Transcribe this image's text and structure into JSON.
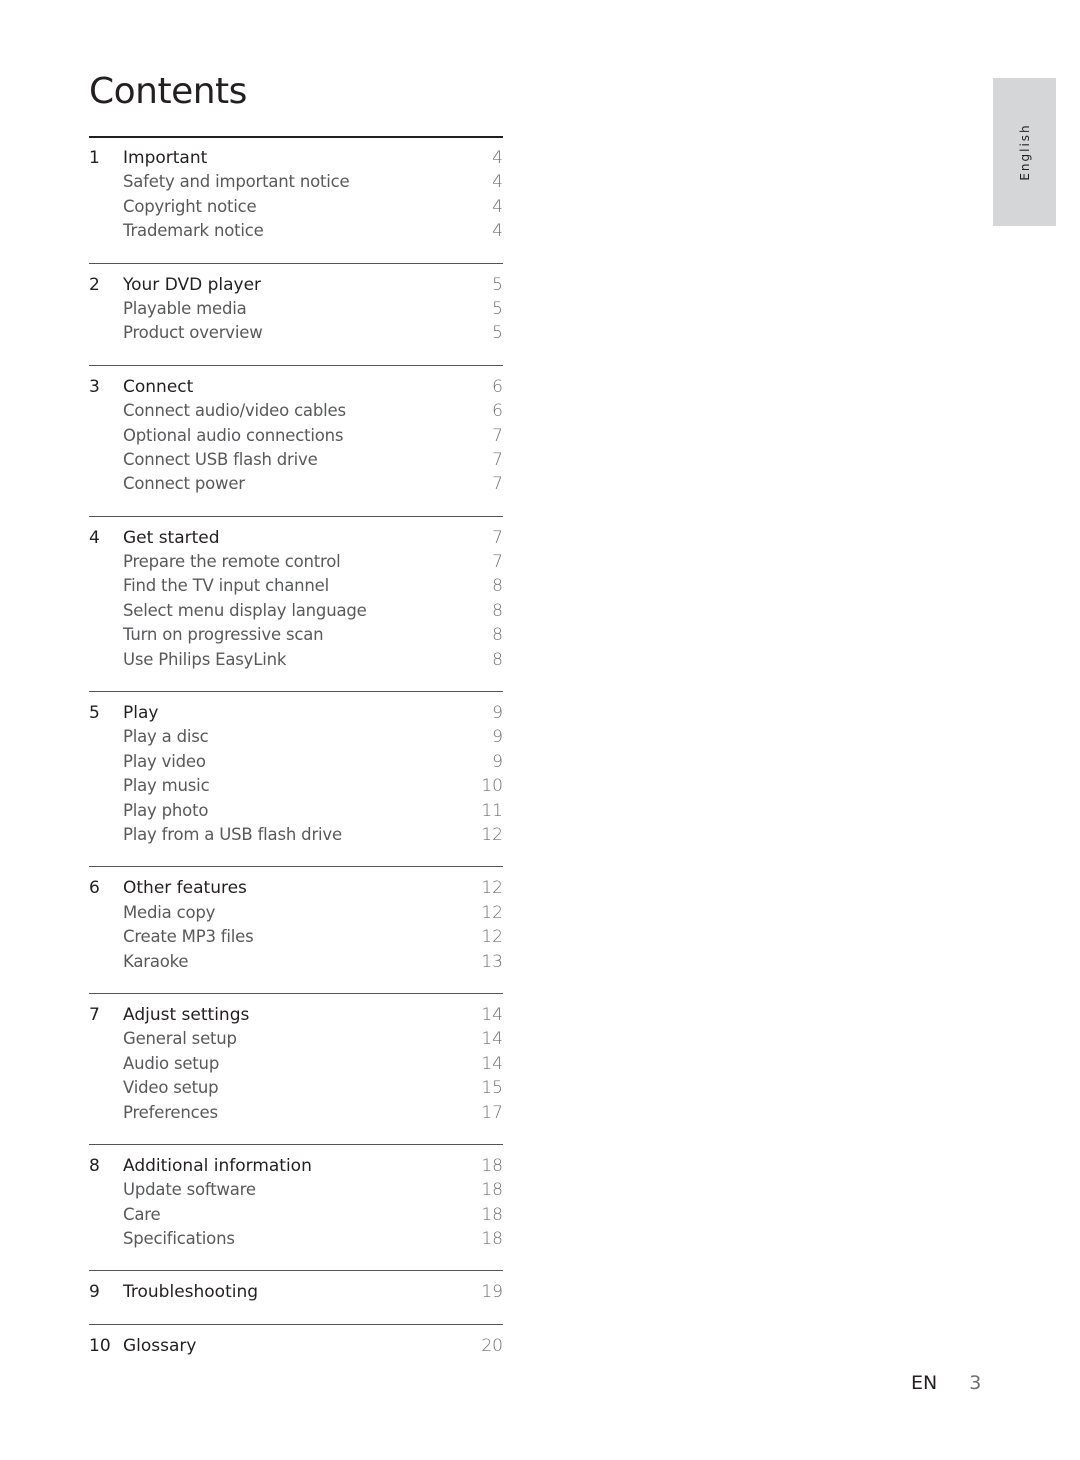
{
  "title": "Contents",
  "language_tab": "English",
  "footer": {
    "lang": "EN",
    "page": "3"
  },
  "sections": [
    {
      "num": "1",
      "title": "Important",
      "page": "4",
      "items": [
        {
          "label": "Safety and important notice",
          "page": "4"
        },
        {
          "label": "Copyright notice",
          "page": "4"
        },
        {
          "label": "Trademark notice",
          "page": "4"
        }
      ]
    },
    {
      "num": "2",
      "title": "Your DVD player",
      "page": "5",
      "items": [
        {
          "label": "Playable media",
          "page": "5"
        },
        {
          "label": "Product overview",
          "page": "5"
        }
      ]
    },
    {
      "num": "3",
      "title": "Connect",
      "page": "6",
      "items": [
        {
          "label": "Connect audio/video cables",
          "page": "6"
        },
        {
          "label": "Optional audio connections",
          "page": "7"
        },
        {
          "label": "Connect USB flash drive",
          "page": "7"
        },
        {
          "label": "Connect power",
          "page": "7"
        }
      ]
    },
    {
      "num": "4",
      "title": "Get started",
      "page": "7",
      "items": [
        {
          "label": "Prepare the remote control",
          "page": "7"
        },
        {
          "label": "Find the TV input channel",
          "page": "8"
        },
        {
          "label": "Select menu display language",
          "page": "8"
        },
        {
          "label": "Turn on progressive scan",
          "page": "8"
        },
        {
          "label": "Use Philips EasyLink",
          "page": "8"
        }
      ]
    },
    {
      "num": "5",
      "title": "Play",
      "page": "9",
      "items": [
        {
          "label": "Play a disc",
          "page": "9"
        },
        {
          "label": "Play video",
          "page": "9"
        },
        {
          "label": "Play music",
          "page": "10"
        },
        {
          "label": "Play photo",
          "page": "11"
        },
        {
          "label": "Play from a USB flash drive",
          "page": "12"
        }
      ]
    },
    {
      "num": "6",
      "title": "Other features",
      "page": "12",
      "items": [
        {
          "label": "Media copy",
          "page": "12"
        },
        {
          "label": "Create MP3 files",
          "page": "12"
        },
        {
          "label": "Karaoke",
          "page": "13"
        }
      ]
    },
    {
      "num": "7",
      "title": "Adjust settings",
      "page": "14",
      "items": [
        {
          "label": "General setup",
          "page": "14"
        },
        {
          "label": "Audio setup",
          "page": "14"
        },
        {
          "label": "Video setup",
          "page": "15"
        },
        {
          "label": "Preferences",
          "page": "17"
        }
      ]
    },
    {
      "num": "8",
      "title": "Additional information",
      "page": "18",
      "items": [
        {
          "label": "Update software",
          "page": "18"
        },
        {
          "label": "Care",
          "page": "18"
        },
        {
          "label": "Specifications",
          "page": "18"
        }
      ]
    },
    {
      "num": "9",
      "title": "Troubleshooting",
      "page": "19",
      "items": []
    },
    {
      "num": "10",
      "title": "Glossary",
      "page": "20",
      "items": []
    }
  ]
}
